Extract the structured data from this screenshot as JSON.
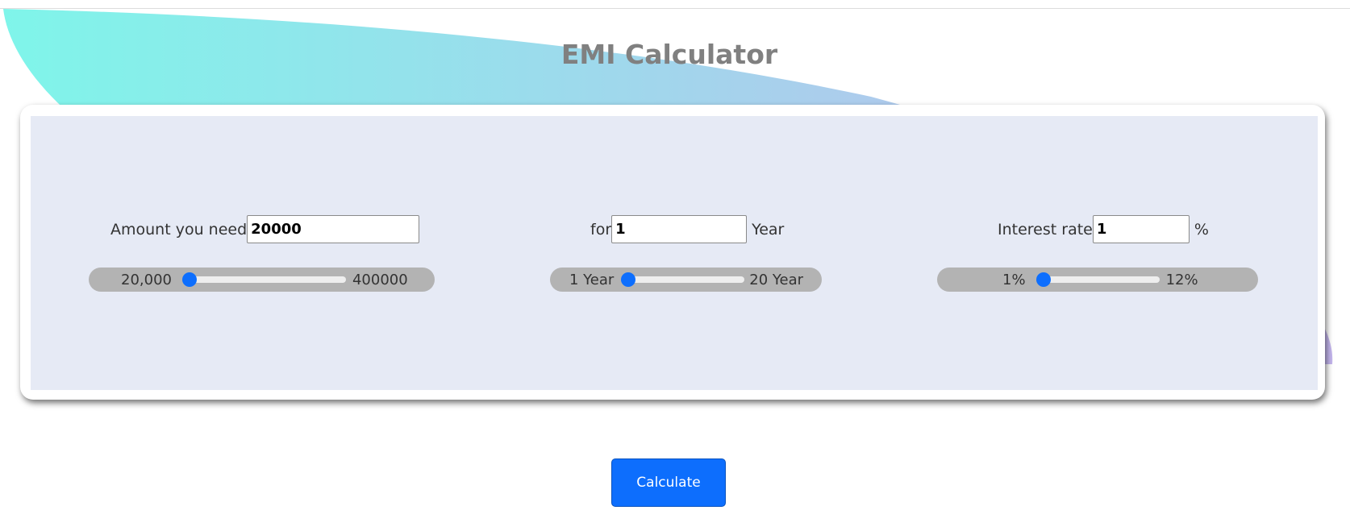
{
  "header": {
    "title": "EMI Calculator"
  },
  "amount": {
    "label": "Amount you need",
    "value": "20000",
    "range_min_label": "20,000",
    "range_max_label": "400000",
    "slider_level": 0
  },
  "tenure": {
    "label": "for",
    "value": "1",
    "unit": "Year",
    "range_min_label": "1 Year",
    "range_max_label": "20 Year",
    "slider_level": 0
  },
  "interest": {
    "label": "Interest rate",
    "value": "1",
    "unit": "%",
    "range_min_label": "1%",
    "range_max_label": "12%",
    "slider_level": 0
  },
  "actions": {
    "calculate_label": "Calculate"
  },
  "colors": {
    "accent": "#0d6efd",
    "title": "#808080",
    "pill": "#b3b3b3",
    "swoosh_start": "#7ff5ea",
    "swoosh_end": "#c5b6ee"
  },
  "icons": [
    "slider-thumb"
  ]
}
